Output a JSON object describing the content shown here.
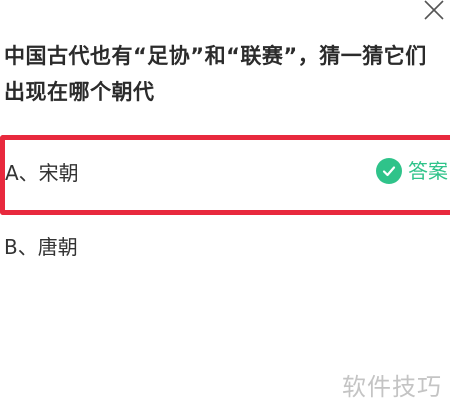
{
  "question": {
    "text": "中国古代也有“足协”和“联赛”，猜一猜它们出现在哪个朝代"
  },
  "options": [
    {
      "label": "A、宋朝",
      "is_answer": true,
      "answer_text": "答案"
    },
    {
      "label": "B、唐朝",
      "is_answer": false
    }
  ],
  "icons": {
    "close": "close-icon",
    "check": "check-circle-icon"
  },
  "colors": {
    "highlight_border": "#e8293d",
    "answer_green": "#2fc38a",
    "watermark_gray": "#c4c4c4"
  },
  "watermark": {
    "text": "软件技巧"
  }
}
